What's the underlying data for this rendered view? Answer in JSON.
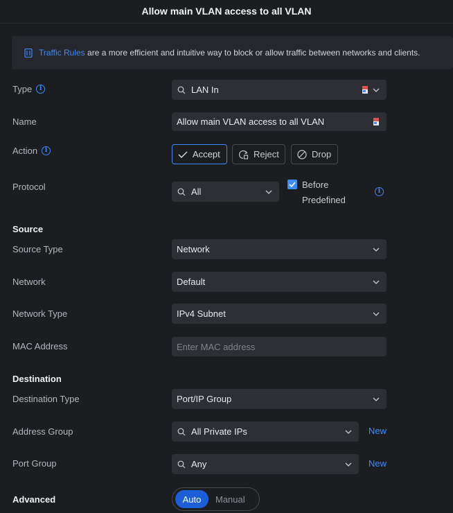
{
  "header": {
    "title": "Allow main VLAN access to all VLAN"
  },
  "banner": {
    "link_text": "Traffic Rules",
    "text": " are a more efficient and intuitive way to block or allow traffic between networks and clients."
  },
  "form": {
    "type": {
      "label": "Type",
      "value": "LAN In"
    },
    "name": {
      "label": "Name",
      "value": "Allow main VLAN access to all VLAN"
    },
    "action": {
      "label": "Action",
      "options": [
        "Accept",
        "Reject",
        "Drop"
      ],
      "selected": "Accept"
    },
    "protocol": {
      "label": "Protocol",
      "value": "All",
      "before_predefined_line1": "Before",
      "before_predefined_line2": "Predefined",
      "before_predefined_checked": true
    }
  },
  "source": {
    "heading": "Source",
    "source_type": {
      "label": "Source Type",
      "value": "Network"
    },
    "network": {
      "label": "Network",
      "value": "Default"
    },
    "network_type": {
      "label": "Network Type",
      "value": "IPv4 Subnet"
    },
    "mac_address": {
      "label": "MAC Address",
      "placeholder": "Enter MAC address"
    }
  },
  "destination": {
    "heading": "Destination",
    "destination_type": {
      "label": "Destination Type",
      "value": "Port/IP Group"
    },
    "address_group": {
      "label": "Address Group",
      "value": "All Private IPs",
      "new_label": "New"
    },
    "port_group": {
      "label": "Port Group",
      "value": "Any",
      "new_label": "New"
    }
  },
  "advanced": {
    "heading": "Advanced",
    "options": [
      "Auto",
      "Manual"
    ],
    "selected": "Auto"
  },
  "colors": {
    "accent": "#3d8bfd",
    "background": "#1c1d21",
    "field": "#2d2f35",
    "toggle_on": "#1a5fd8"
  },
  "icons": [
    "traffic-rules-icon",
    "info-icon",
    "search-icon",
    "chevron-down-icon",
    "flag-icon",
    "checkmark-icon",
    "reject-icon",
    "block-icon",
    "checkbox-checked-icon"
  ]
}
